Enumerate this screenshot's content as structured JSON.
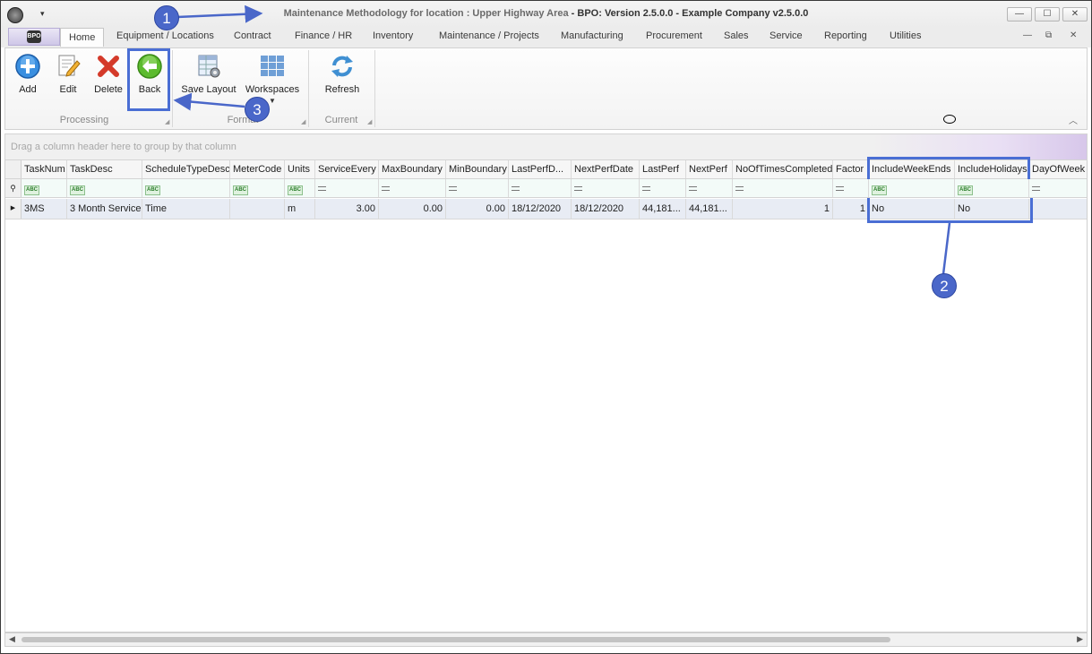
{
  "window": {
    "title_location": "Maintenance Methodology for location : Upper Highway Area",
    "title_suffix": " - BPO: Version 2.5.0.0 - Example Company v2.5.0.0",
    "quick_access": "▾",
    "logo_text": "BPO",
    "minimize": "—",
    "maximize": "☐",
    "close": "✕",
    "mdi_minimize": "—",
    "mdi_restore": "⧉",
    "mdi_close": "✕"
  },
  "tabs": [
    "Home",
    "Equipment / Locations",
    "Contract",
    "Finance / HR",
    "Inventory",
    "Maintenance / Projects",
    "Manufacturing",
    "Procurement",
    "Sales",
    "Service",
    "Reporting",
    "Utilities"
  ],
  "ribbon": {
    "add": "Add",
    "edit": "Edit",
    "delete": "Delete",
    "back": "Back",
    "save_layout": "Save Layout",
    "workspaces": "Workspaces",
    "refresh": "Refresh",
    "group_processing": "Processing",
    "group_format": "Format",
    "group_current": "Current"
  },
  "group_panel_text": "Drag a column header here to group by that column",
  "grid": {
    "columns": [
      "TaskNum",
      "TaskDesc",
      "ScheduleTypeDesc",
      "MeterCode",
      "Units",
      "ServiceEvery",
      "MaxBoundary",
      "MinBoundary",
      "LastPerfD...",
      "NextPerfDate",
      "LastPerf",
      "NextPerf",
      "NoOfTimesCompleted",
      "Factor",
      "IncludeWeekEnds",
      "IncludeHolidays",
      "DayOfWeek"
    ],
    "row": [
      "3MS",
      "3 Month Service",
      "Time",
      "",
      "m",
      "3.00",
      "0.00",
      "0.00",
      "18/12/2020",
      "18/12/2020",
      "44,181...",
      "44,181...",
      "1",
      "1",
      "No",
      "No",
      ""
    ]
  },
  "annotations": {
    "c1": "1",
    "c2": "2",
    "c3": "3",
    "color": "#4a67c9"
  }
}
